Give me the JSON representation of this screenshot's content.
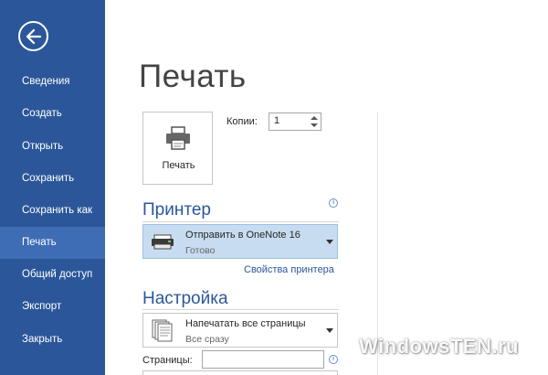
{
  "sidebar": {
    "items": [
      {
        "label": "Сведения"
      },
      {
        "label": "Создать"
      },
      {
        "label": "Открыть"
      },
      {
        "label": "Сохранить"
      },
      {
        "label": "Сохранить как"
      },
      {
        "label": "Печать",
        "active": true
      },
      {
        "label": "Общий доступ"
      },
      {
        "label": "Экспорт"
      },
      {
        "label": "Закрыть"
      }
    ]
  },
  "main": {
    "title": "Печать",
    "print_button": "Печать",
    "copies_label": "Копии:",
    "copies_value": "1",
    "printer": {
      "section_title": "Принтер",
      "name": "Отправить в OneNote 16",
      "status": "Готово",
      "properties_link": "Свойства принтера"
    },
    "settings": {
      "section_title": "Настройка",
      "pages_option": "Напечатать все страницы",
      "pages_option_sub": "Все сразу",
      "pages_label": "Страницы:",
      "pages_value": ""
    }
  },
  "watermark": "WindowsTEN.ru",
  "colors": {
    "sidebar": "#2b579a",
    "sidebar_active": "#3e6db5",
    "accent": "#2b579a",
    "printer_select_bg": "#c8dcf1"
  }
}
